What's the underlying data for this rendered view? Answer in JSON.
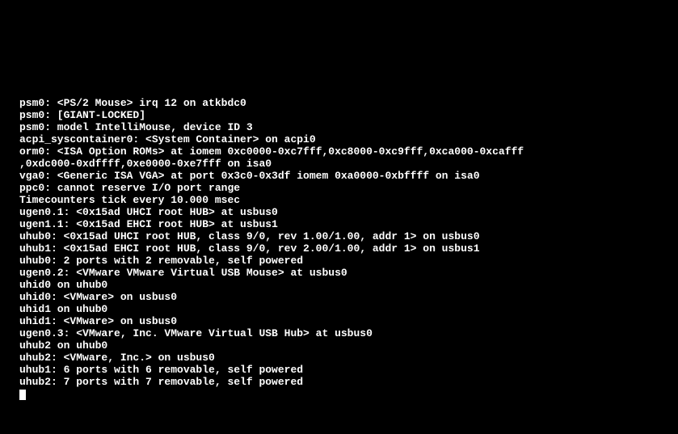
{
  "boot_log": {
    "lines": [
      "psm0: <PS/2 Mouse> irq 12 on atkbdc0",
      "psm0: [GIANT-LOCKED]",
      "psm0: model IntelliMouse, device ID 3",
      "acpi_syscontainer0: <System Container> on acpi0",
      "orm0: <ISA Option ROMs> at iomem 0xc0000-0xc7fff,0xc8000-0xc9fff,0xca000-0xcafff",
      ",0xdc000-0xdffff,0xe0000-0xe7fff on isa0",
      "vga0: <Generic ISA VGA> at port 0x3c0-0x3df iomem 0xa0000-0xbffff on isa0",
      "ppc0: cannot reserve I/O port range",
      "Timecounters tick every 10.000 msec",
      "ugen0.1: <0x15ad UHCI root HUB> at usbus0",
      "ugen1.1: <0x15ad EHCI root HUB> at usbus1",
      "uhub0: <0x15ad UHCI root HUB, class 9/0, rev 1.00/1.00, addr 1> on usbus0",
      "uhub1: <0x15ad EHCI root HUB, class 9/0, rev 2.00/1.00, addr 1> on usbus1",
      "uhub0: 2 ports with 2 removable, self powered",
      "ugen0.2: <VMware VMware Virtual USB Mouse> at usbus0",
      "uhid0 on uhub0",
      "uhid0: <VMware> on usbus0",
      "uhid1 on uhub0",
      "uhid1: <VMware> on usbus0",
      "ugen0.3: <VMware, Inc. VMware Virtual USB Hub> at usbus0",
      "uhub2 on uhub0",
      "uhub2: <VMware, Inc.> on usbus0",
      "uhub1: 6 ports with 6 removable, self powered",
      "uhub2: 7 ports with 7 removable, self powered"
    ]
  }
}
